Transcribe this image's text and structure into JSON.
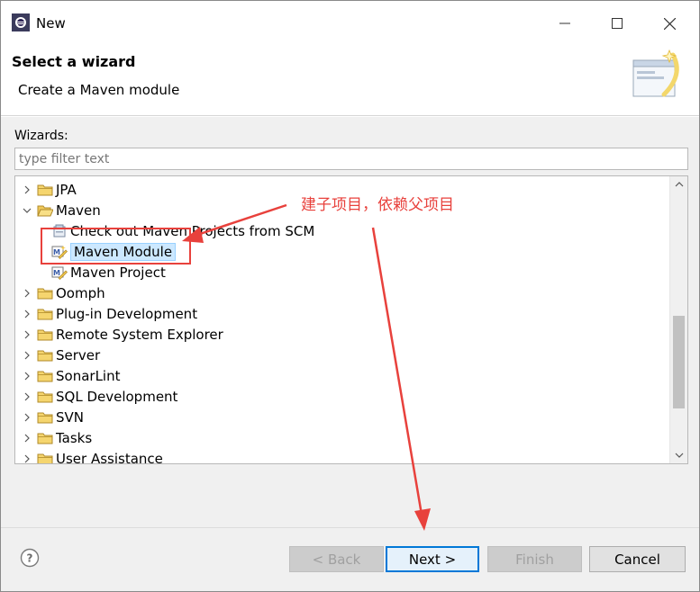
{
  "window": {
    "title": "New"
  },
  "header": {
    "title": "Select a wizard",
    "subtitle": "Create a Maven module"
  },
  "wizards_label": "Wizards:",
  "filter": {
    "placeholder": "type filter text",
    "value": ""
  },
  "tree": {
    "items": [
      {
        "label": "JPA",
        "level": 0,
        "expanded": false,
        "icon": "folder-icon"
      },
      {
        "label": "Maven",
        "level": 0,
        "expanded": true,
        "icon": "folder-icon"
      },
      {
        "label": "Check out Maven Projects from SCM",
        "level": 1,
        "icon": "scm-checkout-icon"
      },
      {
        "label": "Maven Module",
        "level": 1,
        "icon": "maven-module-icon",
        "selected": true
      },
      {
        "label": "Maven Project",
        "level": 1,
        "icon": "maven-project-icon"
      },
      {
        "label": "Oomph",
        "level": 0,
        "expanded": false,
        "icon": "folder-icon"
      },
      {
        "label": "Plug-in Development",
        "level": 0,
        "expanded": false,
        "icon": "folder-icon"
      },
      {
        "label": "Remote System Explorer",
        "level": 0,
        "expanded": false,
        "icon": "folder-icon"
      },
      {
        "label": "Server",
        "level": 0,
        "expanded": false,
        "icon": "folder-icon"
      },
      {
        "label": "SonarLint",
        "level": 0,
        "expanded": false,
        "icon": "folder-icon"
      },
      {
        "label": "SQL Development",
        "level": 0,
        "expanded": false,
        "icon": "folder-icon"
      },
      {
        "label": "SVN",
        "level": 0,
        "expanded": false,
        "icon": "folder-icon"
      },
      {
        "label": "Tasks",
        "level": 0,
        "expanded": false,
        "icon": "folder-icon"
      },
      {
        "label": "User Assistance",
        "level": 0,
        "expanded": false,
        "icon": "folder-icon"
      }
    ]
  },
  "buttons": {
    "back": "< Back",
    "next": "Next >",
    "finish": "Finish",
    "cancel": "Cancel"
  },
  "annotation": {
    "text": "建子项目，依赖父项目",
    "color": "#e8413c"
  },
  "colors": {
    "selection_bg": "#cce8ff",
    "default_button_border": "#0078d7",
    "folder": "#e8b84a"
  }
}
